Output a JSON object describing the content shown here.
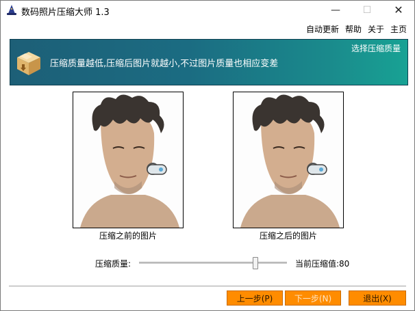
{
  "window": {
    "title": "数码照片压缩大师 1.3",
    "controls": {
      "minimize": "—",
      "maximize": "☐",
      "close": "✕"
    }
  },
  "menu": [
    {
      "label": "自动更新"
    },
    {
      "label": "帮助"
    },
    {
      "label": "关于"
    },
    {
      "label": "主页"
    }
  ],
  "banner": {
    "link": "选择压缩质量",
    "message": "压缩质量越低,压缩后图片就越小,不过图片质量也相应变差"
  },
  "preview": {
    "before_caption": "压缩之前的图片",
    "after_caption": "压缩之后的图片"
  },
  "quality": {
    "label": "压缩质量:",
    "current_label": "当前压缩值:80",
    "value": 80,
    "min": 0,
    "max": 100
  },
  "buttons": {
    "prev": "上一步(P)",
    "next": "下一步(N)",
    "exit": "退出(X)"
  },
  "colors": {
    "banner_start": "#1d5f77",
    "banner_end": "#18a294",
    "button": "#ff8c00"
  }
}
